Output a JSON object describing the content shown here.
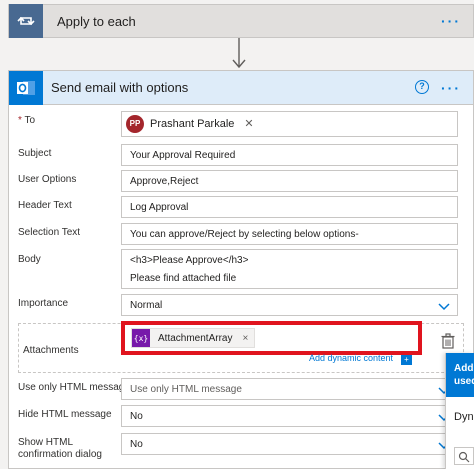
{
  "loop": {
    "title": "Apply to each"
  },
  "email": {
    "title": "Send email with options",
    "fields": {
      "to": {
        "label": "To",
        "required_mark": "*",
        "token_initials": "PP",
        "token_name": "Prashant Parkale",
        "remove": "✕"
      },
      "subject": {
        "label": "Subject",
        "value": "Your Approval Required"
      },
      "user_options": {
        "label": "User Options",
        "value": "Approve,Reject"
      },
      "header_text": {
        "label": "Header Text",
        "value": "Log Approval"
      },
      "selection_text": {
        "label": "Selection Text",
        "value": "You can approve/Reject by selecting below options-"
      },
      "body": {
        "label": "Body",
        "line1": "<h3>Please Approve</h3>",
        "line2": "Please find attached file"
      },
      "importance": {
        "label": "Importance",
        "value": "Normal"
      },
      "attachments": {
        "label": "Attachments",
        "token_icon": "{x}",
        "token_name": "AttachmentArray",
        "remove": "×",
        "add_dynamic": "Add dynamic content"
      },
      "use_only_html": {
        "label": "Use only HTML message",
        "value": "Use only HTML message"
      },
      "hide_html": {
        "label": "Hide HTML message",
        "value": "No"
      },
      "show_html_dialog": {
        "label_line1": "Show HTML",
        "label_line2": "confirmation dialog",
        "value": "No"
      }
    }
  },
  "flyout": {
    "head_line1": "Add",
    "head_line2": "used",
    "tab": "Dyna"
  },
  "icons": {
    "loop": "loop-arrows-icon",
    "outlook": "outlook-icon",
    "help": "help-icon",
    "more": "more-dots-icon",
    "chevron": "chevron-down-icon",
    "trash": "trash-icon",
    "search": "search-icon"
  },
  "colors": {
    "accent": "#0078d4",
    "loop": "#486991",
    "highlight": "#e0141e",
    "dynamic": "#7719aa",
    "avatar": "#a4262c"
  }
}
